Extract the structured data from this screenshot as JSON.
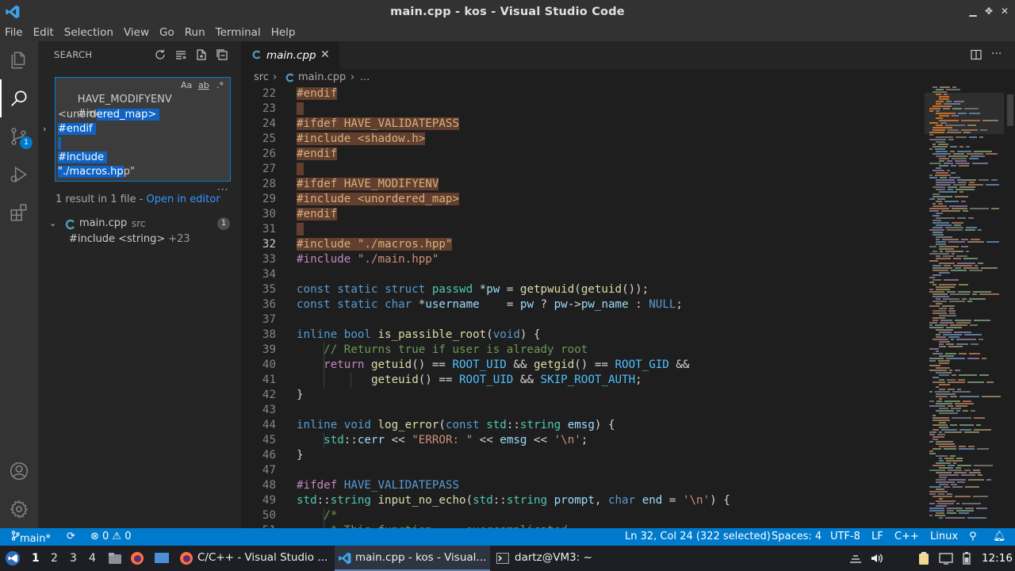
{
  "window": {
    "title": "main.cpp - kos - Visual Studio Code"
  },
  "menu": [
    "File",
    "Edit",
    "Selection",
    "View",
    "Go",
    "Run",
    "Terminal",
    "Help"
  ],
  "activity_bar": {
    "items": [
      "explorer-icon",
      "search-icon",
      "source-control-icon",
      "run-debug-icon",
      "extensions-icon",
      "account-icon",
      "settings-gear-icon"
    ],
    "source_control_badge": "1"
  },
  "sidebar": {
    "header": "SEARCH",
    "search_lines": [
      {
        "pre": "HAVE_MODIFYENV",
        "sel": "",
        "post": ""
      },
      {
        "pre": "#include",
        "sel": "",
        "post": ""
      },
      {
        "pre": "<unord",
        "sel": "ered_map>",
        "post": ""
      },
      {
        "pre": "",
        "sel": "#endif",
        "post": ""
      },
      {
        "pre": "",
        "sel": " ",
        "post": ""
      },
      {
        "pre": "",
        "sel": "#include",
        "post": ""
      },
      {
        "pre": "",
        "sel": "\"./macros.hp",
        "post": "p\""
      }
    ],
    "search_options": [
      "Aa",
      "ab",
      ".*"
    ],
    "result_summary": "1 result in 1 file - ",
    "open_in_editor": "Open in editor",
    "file": {
      "name": "main.cpp",
      "path": "src",
      "count": "1"
    },
    "match": {
      "text": "#include <string>",
      "extra": "+23"
    }
  },
  "editor": {
    "tab": {
      "name": "main.cpp",
      "close": "✕"
    },
    "breadcrumb": [
      "src",
      "›",
      "main.cpp",
      "›",
      "..."
    ],
    "lines": [
      {
        "n": "22",
        "sel": true,
        "html": "<span class=\"pp\">#endif</span>"
      },
      {
        "n": "23",
        "sel": true,
        "html": " "
      },
      {
        "n": "24",
        "sel": true,
        "html": "<span class=\"pp\">#ifdef</span> <span class=\"mac\">HAVE_VALIDATEPASS</span>"
      },
      {
        "n": "25",
        "sel": true,
        "html": "<span class=\"pp\">#include</span> <span class=\"str\">&lt;shadow.h&gt;</span>"
      },
      {
        "n": "26",
        "sel": true,
        "html": "<span class=\"pp\">#endif</span>"
      },
      {
        "n": "27",
        "sel": true,
        "html": " "
      },
      {
        "n": "28",
        "sel": true,
        "html": "<span class=\"pp\">#ifdef</span> <span class=\"mac\">HAVE_MODIFYENV</span>"
      },
      {
        "n": "29",
        "sel": true,
        "html": "<span class=\"pp\">#include</span> <span class=\"str\">&lt;unordered_map&gt;</span>"
      },
      {
        "n": "30",
        "sel": true,
        "html": "<span class=\"pp\">#endif</span>"
      },
      {
        "n": "31",
        "sel": true,
        "html": " "
      },
      {
        "n": "32",
        "sel": true,
        "cur": true,
        "html": "<span class=\"pp\">#include</span> <span class=\"str\">\"./macros.hpp\"</span>"
      },
      {
        "n": "33",
        "html": "<span class=\"pp\">#include</span> <span class=\"str\">\"./main.hpp\"</span>"
      },
      {
        "n": "34",
        "html": ""
      },
      {
        "n": "35",
        "html": "<span class=\"kw\">const</span> <span class=\"kw\">static</span> <span class=\"kw\">struct</span> <span class=\"ty\">passwd</span> *<span class=\"var\">pw</span> = <span class=\"fn\">getpwuid</span>(<span class=\"fn\">getuid</span>());"
      },
      {
        "n": "36",
        "html": "<span class=\"kw\">const</span> <span class=\"kw\">static</span> <span class=\"kw\">char</span> *<span class=\"var\">username</span>    = <span class=\"var\">pw</span> ? <span class=\"var\">pw</span>-&gt;<span class=\"var\">pw_name</span> : <span class=\"kw\">NULL</span>;"
      },
      {
        "n": "37",
        "html": ""
      },
      {
        "n": "38",
        "html": "<span class=\"kw\">inline</span> <span class=\"kw\">bool</span> <span class=\"fn\">is_passible_root</span>(<span class=\"kw\">void</span>) {"
      },
      {
        "n": "39",
        "html": "    <span class=\"cm\">// Returns true if user is already root</span>"
      },
      {
        "n": "40",
        "html": "    <span class=\"ctl\">return</span> <span class=\"fn\">getuid</span>() == <span class=\"cst\">ROOT_UID</span> &amp;&amp; <span class=\"fn\">getgid</span>() == <span class=\"cst\">ROOT_GID</span> &amp;&amp;"
      },
      {
        "n": "41",
        "html": "           <span class=\"fn\">geteuid</span>() == <span class=\"cst\">ROOT_UID</span> &amp;&amp; <span class=\"cst\">SKIP_ROOT_AUTH</span>;"
      },
      {
        "n": "42",
        "html": "}"
      },
      {
        "n": "43",
        "html": ""
      },
      {
        "n": "44",
        "html": "<span class=\"kw\">inline</span> <span class=\"kw\">void</span> <span class=\"fn\">log_error</span>(<span class=\"kw\">const</span> <span class=\"ty\">std</span>::<span class=\"ty\">string</span> <span class=\"var\">emsg</span>) {"
      },
      {
        "n": "45",
        "html": "    <span class=\"ty\">std</span>::<span class=\"var\">cerr</span> &lt;&lt; <span class=\"str\">\"ERROR: \"</span> &lt;&lt; <span class=\"var\">emsg</span> &lt;&lt; <span class=\"str\">'\\n'</span>;"
      },
      {
        "n": "46",
        "html": "}"
      },
      {
        "n": "47",
        "html": ""
      },
      {
        "n": "48",
        "html": "<span class=\"pp\">#ifdef</span> <span class=\"mac\">HAVE_VALIDATEPASS</span>"
      },
      {
        "n": "49",
        "html": "<span class=\"ty\">std</span>::<span class=\"ty\">string</span> <span class=\"fn\">input_no_echo</span>(<span class=\"ty\">std</span>::<span class=\"ty\">string</span> <span class=\"var\">prompt</span>, <span class=\"kw\">char</span> <span class=\"var\">end</span> = <span class=\"str\">'\\n'</span>) {"
      },
      {
        "n": "50",
        "html": "    <span class=\"cm\">/*</span>"
      },
      {
        "n": "51",
        "html": "     <span class=\"cm\">* This function ... overcomplicated</span>"
      }
    ]
  },
  "status_bar": {
    "branch": "main*",
    "sync": "⟳",
    "problems": "⊗ 0 ⚠ 0",
    "position": "Ln 32, Col 24 (322 selected)",
    "spaces": "Spaces: 4",
    "encoding": "UTF-8",
    "eol": "LF",
    "language": "C++",
    "os": "Linux"
  },
  "taskbar": {
    "workspaces": [
      "1",
      "2",
      "3",
      "4"
    ],
    "windows": [
      {
        "label": "C/C++ - Visual Studio ...",
        "icon": "firefox-icon"
      },
      {
        "label": "main.cpp - kos - Visual...",
        "icon": "vscode-icon"
      },
      {
        "label": "dartz@VM3: ~",
        "icon": "terminal-icon"
      }
    ],
    "clock": "12:16"
  },
  "colors": {
    "accent": "#007acc",
    "selection_highlight": "#623f2e",
    "search_selection": "#0e63c4"
  }
}
